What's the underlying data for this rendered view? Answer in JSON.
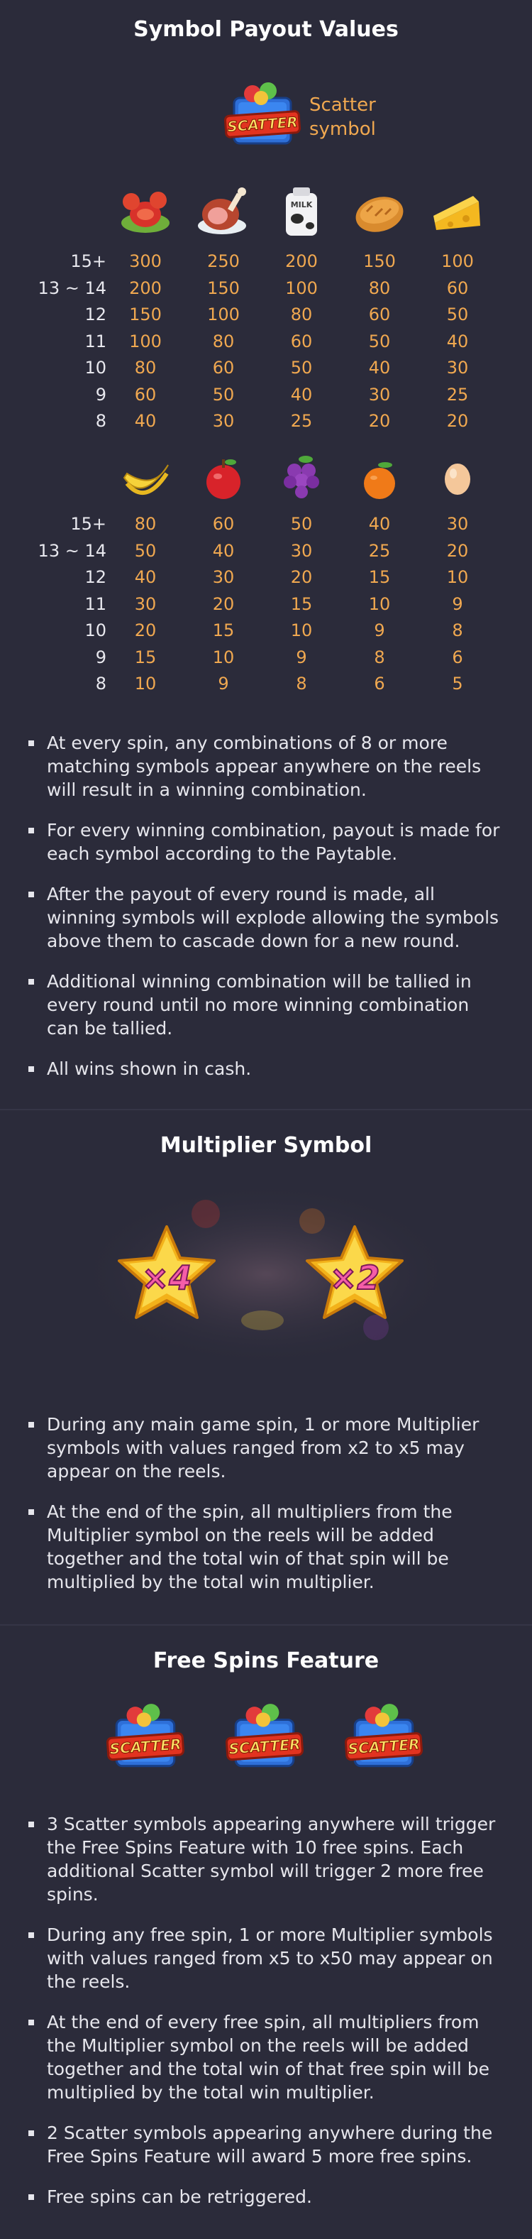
{
  "sections": {
    "payout": {
      "title": "Symbol Payout Values",
      "scatter_text": "SCATTER",
      "scatter_label": "Scatter symbol",
      "table1": {
        "icons": [
          "lobster-icon",
          "ham-icon",
          "milk-icon",
          "bread-icon",
          "cheese-icon"
        ],
        "milk_text": "MILK",
        "rows": [
          {
            "count": "15+",
            "values": [
              "300",
              "250",
              "200",
              "150",
              "100"
            ]
          },
          {
            "count": "13 ~ 14",
            "values": [
              "200",
              "150",
              "100",
              "80",
              "60"
            ]
          },
          {
            "count": "12",
            "values": [
              "150",
              "100",
              "80",
              "60",
              "50"
            ]
          },
          {
            "count": "11",
            "values": [
              "100",
              "80",
              "60",
              "50",
              "40"
            ]
          },
          {
            "count": "10",
            "values": [
              "80",
              "60",
              "50",
              "40",
              "30"
            ]
          },
          {
            "count": "9",
            "values": [
              "60",
              "50",
              "40",
              "30",
              "25"
            ]
          },
          {
            "count": "8",
            "values": [
              "40",
              "30",
              "25",
              "20",
              "20"
            ]
          }
        ]
      },
      "table2": {
        "icons": [
          "banana-icon",
          "apple-icon",
          "grapes-icon",
          "orange-icon",
          "egg-icon"
        ],
        "rows": [
          {
            "count": "15+",
            "values": [
              "80",
              "60",
              "50",
              "40",
              "30"
            ]
          },
          {
            "count": "13 ~ 14",
            "values": [
              "50",
              "40",
              "30",
              "25",
              "20"
            ]
          },
          {
            "count": "12",
            "values": [
              "40",
              "30",
              "20",
              "15",
              "10"
            ]
          },
          {
            "count": "11",
            "values": [
              "30",
              "20",
              "15",
              "10",
              "9"
            ]
          },
          {
            "count": "10",
            "values": [
              "20",
              "15",
              "10",
              "9",
              "8"
            ]
          },
          {
            "count": "9",
            "values": [
              "15",
              "10",
              "9",
              "8",
              "6"
            ]
          },
          {
            "count": "8",
            "values": [
              "10",
              "9",
              "8",
              "6",
              "5"
            ]
          }
        ]
      },
      "rules": [
        "At every spin, any combinations of 8 or more matching symbols appear anywhere on the reels will result in a winning combination.",
        "For every winning combination, payout is made for each symbol according to the Paytable.",
        "After the payout of every round is made, all winning symbols will explode allowing the symbols above them to cascade down for a new round.",
        "Additional winning combination will be tallied in every round until no more winning combination can be tallied.",
        "All wins shown in cash."
      ]
    },
    "multiplier": {
      "title": "Multiplier Symbol",
      "symbols": [
        "×4",
        "×2"
      ],
      "rules": [
        "During any main game spin, 1 or more Multiplier symbols with values ranged from x2 to x5 may appear on the reels.",
        "At the end of the spin, all multipliers from the Multiplier symbol on the reels will be added together and the total win of that spin will be multiplied by the total win multiplier."
      ]
    },
    "free_spins": {
      "title": "Free Spins Feature",
      "rules": [
        "3 Scatter symbols appearing anywhere will trigger the Free Spins Feature with 10 free spins. Each additional Scatter symbol will trigger 2 more free spins.",
        "During any free spin, 1 or more Multiplier symbols with values ranged from x5 to x50 may appear on the reels.",
        "At the end of every free spin, all multipliers from the Multiplier symbol on the reels will be added together and the total win of that free spin will be multiplied by the total win multiplier.",
        "2 Scatter symbols appearing anywhere during the Free Spins Feature will award 5 more free spins.",
        "Free spins can be retriggered."
      ]
    }
  },
  "colors": {
    "background": "#2b2b3a",
    "accent": "#f0a850",
    "text": "#ececf2"
  }
}
